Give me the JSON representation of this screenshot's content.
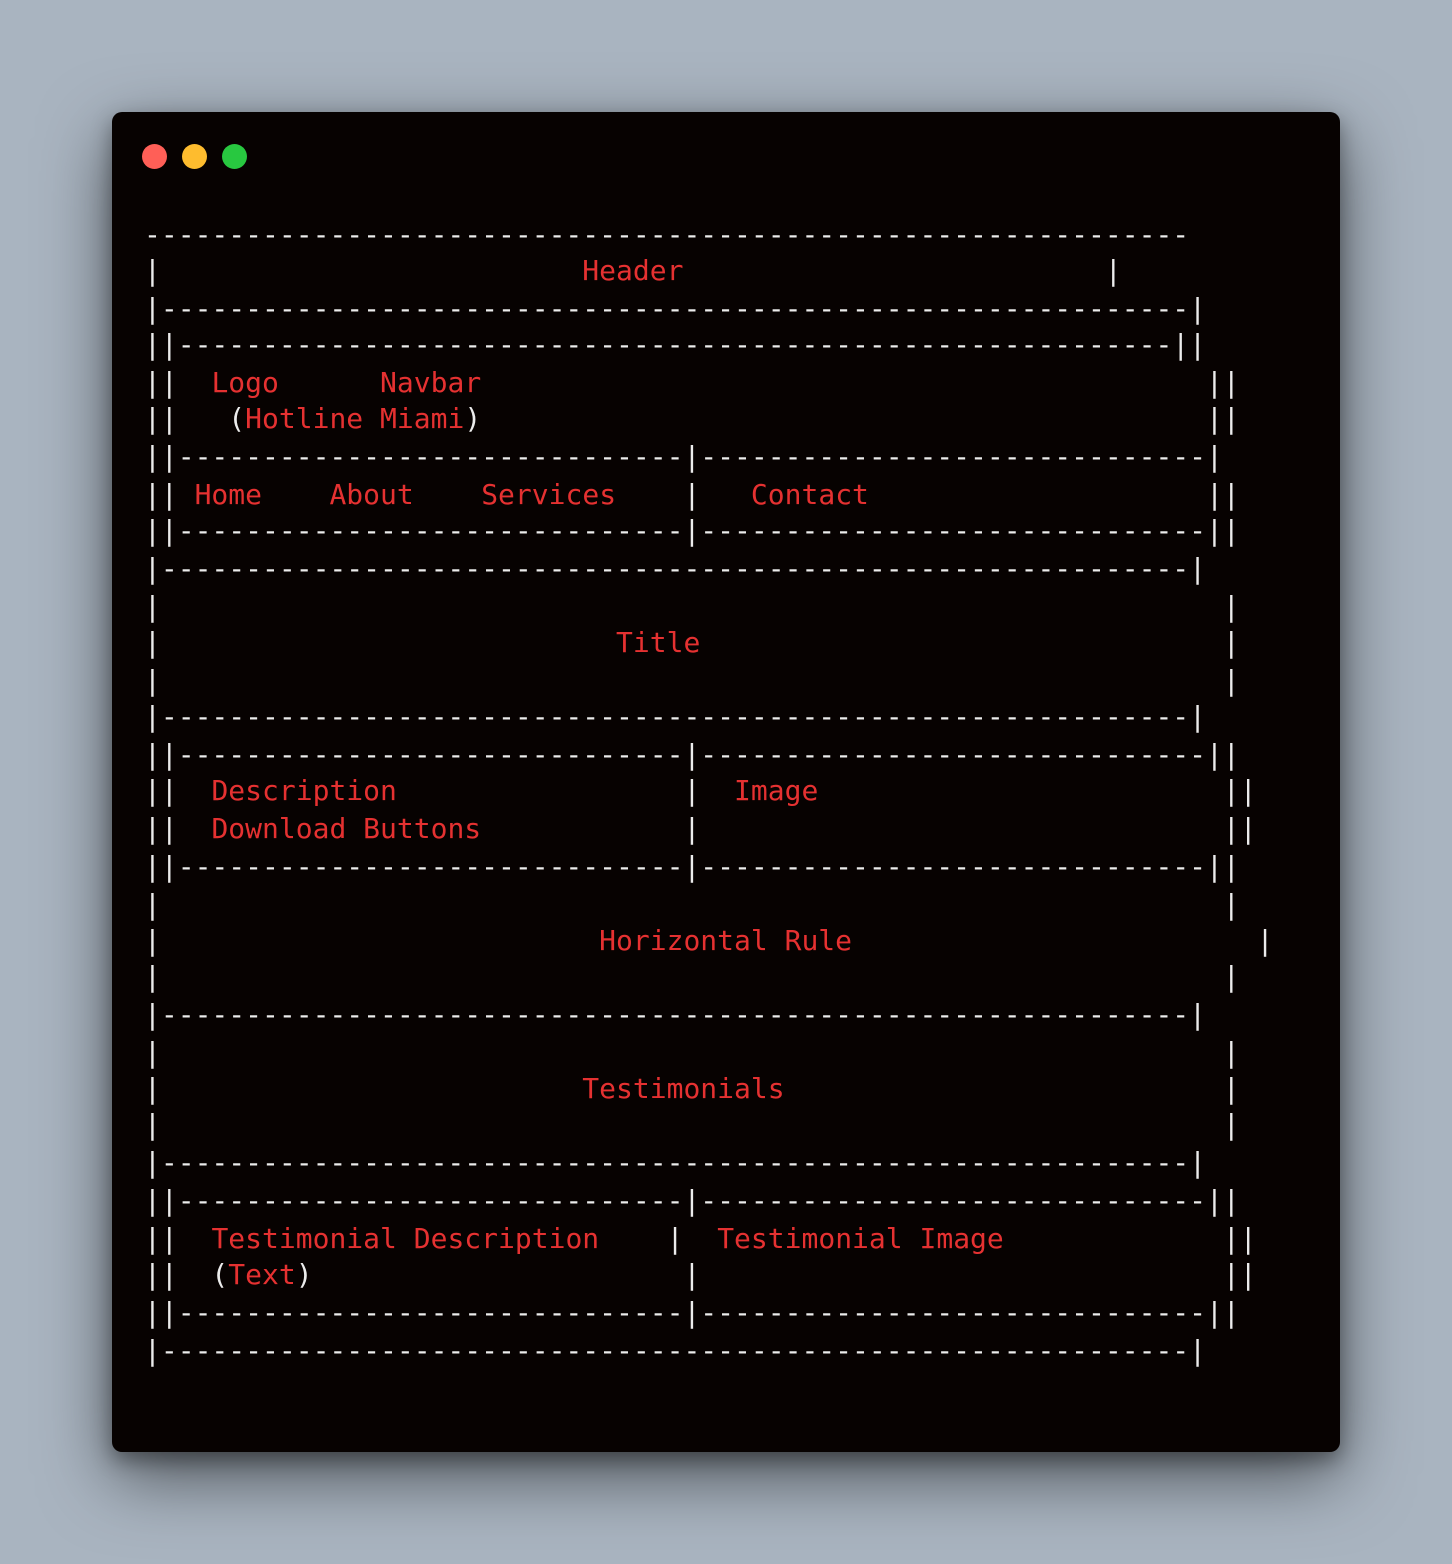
{
  "window": {
    "buttons": [
      {
        "name": "close",
        "color": "#ff5f57"
      },
      {
        "name": "minimize",
        "color": "#febc2e"
      },
      {
        "name": "maximize",
        "color": "#28c840"
      }
    ]
  },
  "colors": {
    "background": "#070201",
    "text_white": "#ececec",
    "text_red": "#e53131"
  },
  "terminal": {
    "lines": [
      [
        {
          "t": "--------------------------------------------------------------",
          "c": "w"
        }
      ],
      [
        {
          "t": "|                         ",
          "c": "w"
        },
        {
          "t": "Header",
          "c": "r"
        },
        {
          "t": "                         |",
          "c": "w"
        }
      ],
      [
        {
          "t": "|-------------------------------------------------------------|",
          "c": "w"
        }
      ],
      [
        {
          "t": "||-----------------------------------------------------------||",
          "c": "w"
        }
      ],
      [
        {
          "t": "||  ",
          "c": "w"
        },
        {
          "t": "Logo",
          "c": "r"
        },
        {
          "t": "      ",
          "c": "w"
        },
        {
          "t": "Navbar",
          "c": "r"
        },
        {
          "t": "                                           ||",
          "c": "w"
        }
      ],
      [
        {
          "t": "||   (",
          "c": "w"
        },
        {
          "t": "Hotline Miami",
          "c": "r"
        },
        {
          "t": ")",
          "c": "w"
        },
        {
          "t": "                                           ||",
          "c": "w"
        }
      ],
      [
        {
          "t": "||------------------------------|------------------------------|",
          "c": "w"
        }
      ],
      [
        {
          "t": "|| ",
          "c": "w"
        },
        {
          "t": "Home",
          "c": "r"
        },
        {
          "t": "    ",
          "c": "w"
        },
        {
          "t": "About",
          "c": "r"
        },
        {
          "t": "    ",
          "c": "w"
        },
        {
          "t": "Services",
          "c": "r"
        },
        {
          "t": "    |   ",
          "c": "w"
        },
        {
          "t": "Contact",
          "c": "r"
        },
        {
          "t": "                    ||",
          "c": "w"
        }
      ],
      [
        {
          "t": "||------------------------------|------------------------------||",
          "c": "w"
        }
      ],
      [
        {
          "t": "|-------------------------------------------------------------|",
          "c": "w"
        }
      ],
      [
        {
          "t": "|                                                               |",
          "c": "w"
        }
      ],
      [
        {
          "t": "|                           ",
          "c": "w"
        },
        {
          "t": "Title",
          "c": "r"
        },
        {
          "t": "                               |",
          "c": "w"
        }
      ],
      [
        {
          "t": "|                                                               |",
          "c": "w"
        }
      ],
      [
        {
          "t": "|-------------------------------------------------------------|",
          "c": "w"
        }
      ],
      [
        {
          "t": "||------------------------------|------------------------------||",
          "c": "w"
        }
      ],
      [
        {
          "t": "||  ",
          "c": "w"
        },
        {
          "t": "Description",
          "c": "r"
        },
        {
          "t": "                 |  ",
          "c": "w"
        },
        {
          "t": "Image",
          "c": "r"
        },
        {
          "t": "                        ||",
          "c": "w"
        }
      ],
      [
        {
          "t": "||  ",
          "c": "w"
        },
        {
          "t": "Download Buttons",
          "c": "r"
        },
        {
          "t": "            |                               ||",
          "c": "w"
        }
      ],
      [
        {
          "t": "||------------------------------|------------------------------||",
          "c": "w"
        }
      ],
      [
        {
          "t": "|                                                               |",
          "c": "w"
        }
      ],
      [
        {
          "t": "|                          ",
          "c": "w"
        },
        {
          "t": "Horizontal Rule",
          "c": "r"
        },
        {
          "t": "                        |",
          "c": "w"
        }
      ],
      [
        {
          "t": "|                                                               |",
          "c": "w"
        }
      ],
      [
        {
          "t": "|-------------------------------------------------------------|",
          "c": "w"
        }
      ],
      [
        {
          "t": "|                                                               |",
          "c": "w"
        }
      ],
      [
        {
          "t": "|                         ",
          "c": "w"
        },
        {
          "t": "Testimonials",
          "c": "r"
        },
        {
          "t": "                          |",
          "c": "w"
        }
      ],
      [
        {
          "t": "|                                                               |",
          "c": "w"
        }
      ],
      [
        {
          "t": "|-------------------------------------------------------------|",
          "c": "w"
        }
      ],
      [
        {
          "t": "||------------------------------|------------------------------||",
          "c": "w"
        }
      ],
      [
        {
          "t": "||  ",
          "c": "w"
        },
        {
          "t": "Testimonial Description",
          "c": "r"
        },
        {
          "t": "    |  ",
          "c": "w"
        },
        {
          "t": "Testimonial Image",
          "c": "r"
        },
        {
          "t": "             ||",
          "c": "w"
        }
      ],
      [
        {
          "t": "||  (",
          "c": "w"
        },
        {
          "t": "Text",
          "c": "r"
        },
        {
          "t": ")",
          "c": "w"
        },
        {
          "t": "                      |                               ||",
          "c": "w"
        }
      ],
      [
        {
          "t": "||------------------------------|------------------------------||",
          "c": "w"
        }
      ],
      [
        {
          "t": "|-------------------------------------------------------------|",
          "c": "w"
        }
      ]
    ]
  }
}
